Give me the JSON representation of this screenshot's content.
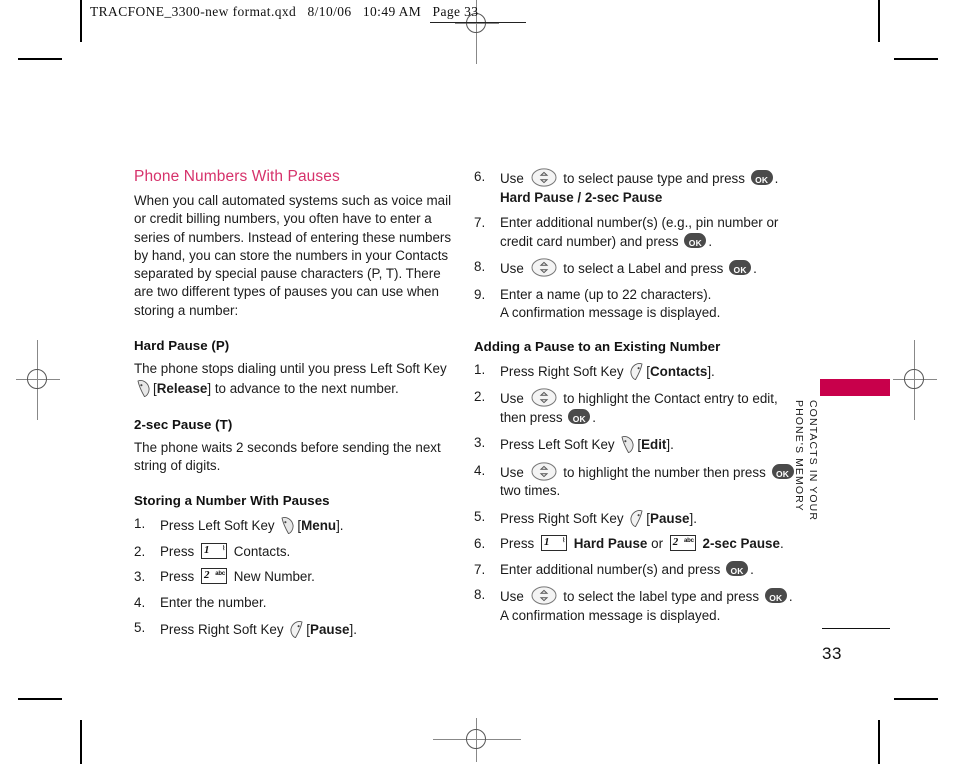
{
  "print_header": {
    "text": "TRACFONE_3300-new format.qxd   8/10/06   10:49 AM   Page 33"
  },
  "left_column": {
    "section_title": "Phone Numbers With Pauses",
    "intro_paragraph": "When you call automated systems such as voice mail or credit billing numbers, you often have to enter a series of numbers. Instead of entering these numbers by hand, you can store the numbers in your Contacts separated by special pause characters (P, T). There are two different types of pauses you can use when storing a number:",
    "hard_pause": {
      "title": "Hard Pause (P)",
      "text_before_icon": "The phone stops dialing until you press Left Soft Key",
      "bracket_open": "[",
      "key_label": "Release",
      "bracket_close": "]",
      "text_after": " to advance to the next number."
    },
    "two_sec_pause": {
      "title": "2-sec Pause (T)",
      "text": "The phone waits 2 seconds before sending the next string of digits."
    },
    "storing": {
      "title": "Storing a Number With Pauses",
      "steps": [
        {
          "num": "1.",
          "pre": "Press Left Soft Key",
          "icon": "left-soft-key-icon",
          "bracket_open": "[",
          "label": "Menu",
          "bracket_close": "].",
          "post": ""
        },
        {
          "num": "2.",
          "pre": "Press",
          "icon": "key-1-icon",
          "post": "Contacts."
        },
        {
          "num": "3.",
          "pre": "Press",
          "icon": "key-2-icon",
          "post": "New Number."
        },
        {
          "num": "4.",
          "pre": "Enter the number.",
          "icon": "",
          "post": ""
        },
        {
          "num": "5.",
          "pre": "Press Right Soft Key",
          "icon": "right-soft-key-icon",
          "bracket_open": "[",
          "label": "Pause",
          "bracket_close": "].",
          "post": ""
        }
      ]
    }
  },
  "right_column": {
    "continued_steps": [
      {
        "num": "6.",
        "pre": "Use",
        "icon": "nav-key-icon",
        "mid": "to select pause type and press",
        "icon2": "ok-key-icon",
        "post": ".",
        "subline": "Hard Pause / 2-sec Pause",
        "subline_bold": true
      },
      {
        "num": "7.",
        "pre": "Enter additional number(s) (e.g., pin number or credit card number) and press",
        "icon2": "ok-key-icon",
        "post": "."
      },
      {
        "num": "8.",
        "pre": "Use",
        "icon": "nav-key-icon",
        "mid": "to select a Label and press",
        "icon2": "ok-key-icon",
        "post": "."
      },
      {
        "num": "9.",
        "pre": "Enter a name (up to 22 characters).",
        "subline": "A confirmation message is displayed."
      }
    ],
    "adding": {
      "title": "Adding a Pause to an Existing Number",
      "steps": [
        {
          "num": "1.",
          "pre": "Press Right Soft Key",
          "icon": "right-soft-key-icon",
          "bracket_open": "[",
          "label": "Contacts",
          "bracket_close": "]."
        },
        {
          "num": "2.",
          "pre": "Use",
          "icon": "nav-key-icon",
          "mid": "to highlight the Contact entry to edit,",
          "subline_pre": "then press",
          "icon2": "ok-key-icon",
          "post": "."
        },
        {
          "num": "3.",
          "pre": "Press Left Soft Key",
          "icon": "left-soft-key-icon",
          "bracket_open": "[",
          "label": "Edit",
          "bracket_close": "]."
        },
        {
          "num": "4.",
          "pre": "Use",
          "icon": "nav-key-icon",
          "mid": "to highlight the number then press",
          "icon2": "ok-key-icon",
          "subline": "two times."
        },
        {
          "num": "5.",
          "pre": "Press Right Soft Key",
          "icon": "right-soft-key-icon",
          "bracket_open": "[",
          "label": "Pause",
          "bracket_close": "]."
        },
        {
          "num": "6.",
          "pre": "Press",
          "icon": "key-1-icon",
          "mid_bold": "Hard Pause",
          "mid2": "or",
          "icon2": "key-2-icon",
          "post_bold": "2-sec Pause",
          "post": "."
        },
        {
          "num": "7.",
          "pre": "Enter additional number(s) and press",
          "icon2": "ok-key-icon",
          "post": "."
        },
        {
          "num": "8.",
          "pre": "Use",
          "icon": "nav-key-icon",
          "mid": "to select the label type and press",
          "icon2": "ok-key-icon",
          "post": ".",
          "subline": "A confirmation message is displayed."
        }
      ]
    }
  },
  "side_tab": {
    "label_line1": "CONTACTS IN YOUR",
    "label_line2": "PHONE'S MEMORY",
    "page_number": "33",
    "accent_color": "#C8004B"
  },
  "keys": {
    "key_1": {
      "digit": "1",
      "sub": "⌇"
    },
    "key_2": {
      "digit": "2",
      "sub": "abc"
    },
    "ok": "OK"
  },
  "colors": {
    "heading": "#D6326B",
    "tab": "#C8004B",
    "body": "#1c1c1c",
    "key_fill": "#4a4a4a"
  }
}
